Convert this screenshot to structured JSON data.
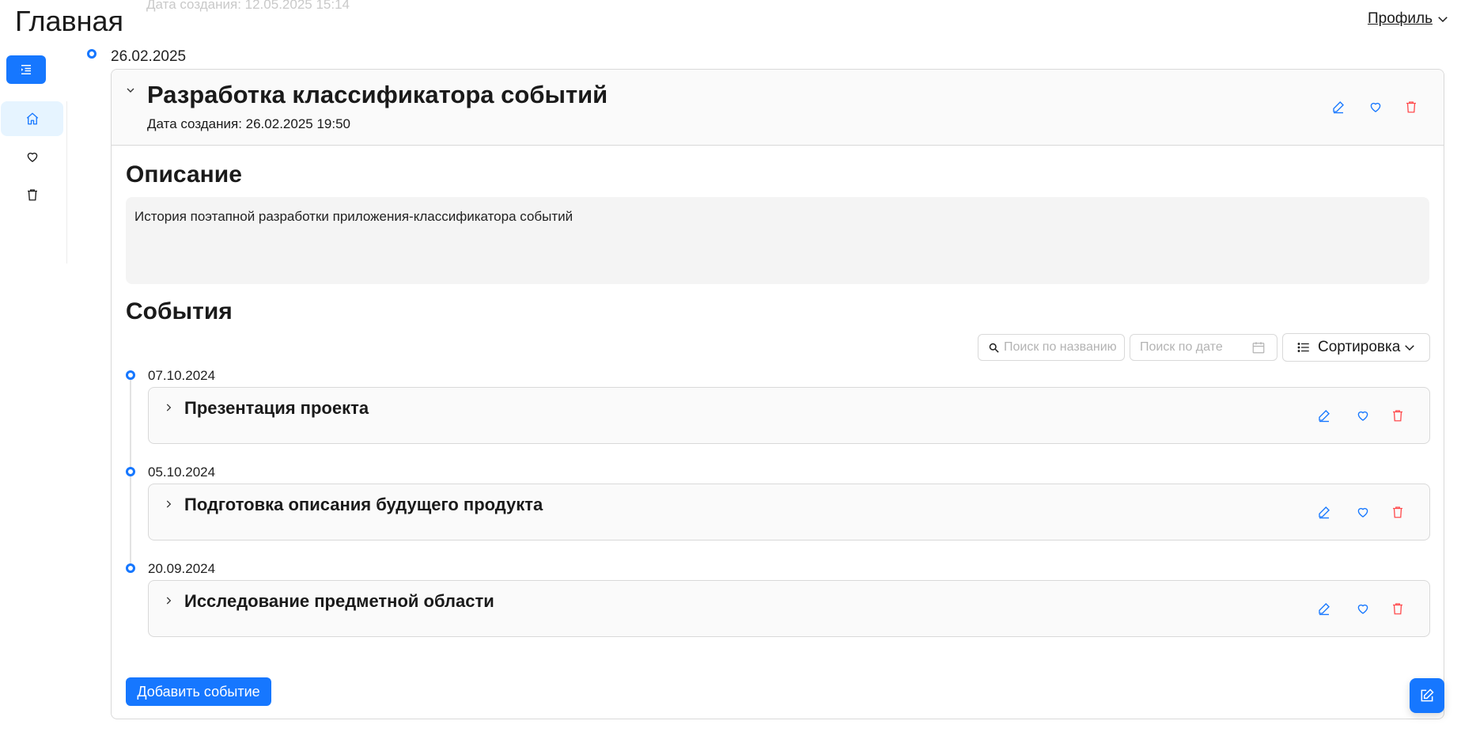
{
  "header": {
    "ghost_text": "Дата создания: 12.05.2025 15:14",
    "page_title": "Главная",
    "profile_label": "Профиль"
  },
  "sidebar": {
    "items": [
      {
        "name": "home",
        "icon": "home-icon",
        "active": true
      },
      {
        "name": "favorites",
        "icon": "heart-icon",
        "active": false
      },
      {
        "name": "trash",
        "icon": "trash-icon",
        "active": false
      }
    ]
  },
  "project": {
    "date": "26.02.2025",
    "title": "Разработка классификатора событий",
    "created": "Дата создания: 26.02.2025 19:50",
    "description_heading": "Описание",
    "description": "История поэтапной разработки приложения-классификатора событий",
    "events_heading": "События",
    "add_button": "Добавить событие"
  },
  "toolbar": {
    "search_placeholder": "Поиск по названию",
    "date_placeholder": "Поиск по дате",
    "sort_label": "Сортировка"
  },
  "events": [
    {
      "date": "07.10.2024",
      "title": "Презентация проекта"
    },
    {
      "date": "05.10.2024",
      "title": "Подготовка описания будущего продукта"
    },
    {
      "date": "20.09.2024",
      "title": "Исследование предметной области"
    }
  ],
  "colors": {
    "accent": "#1677ff",
    "danger": "#ff4d4f",
    "active_bg": "#e6f4ff"
  }
}
